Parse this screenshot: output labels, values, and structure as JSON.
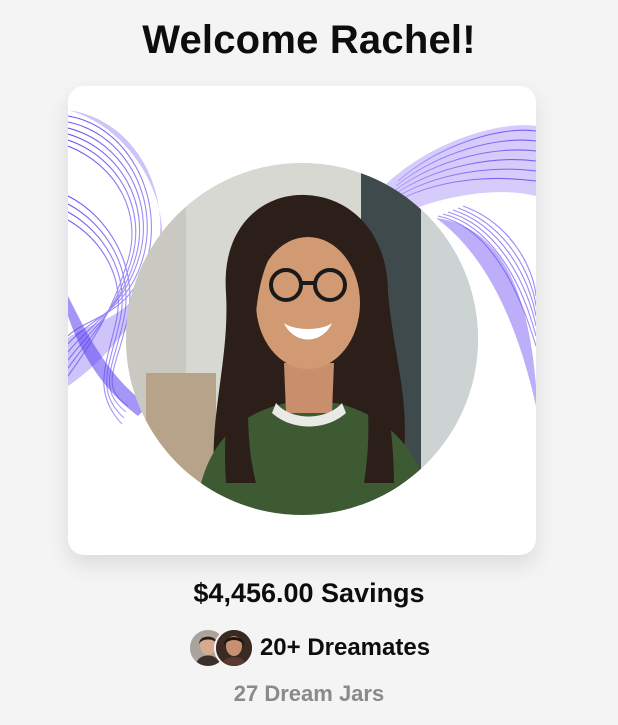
{
  "header": {
    "title": "Welcome Rachel!"
  },
  "profile": {
    "photo_icon": "profile-photo",
    "ribbon_color": "#6a4bf0"
  },
  "stats": {
    "savings": "$4,456.00 Savings",
    "dreamates": "20+ Dreamates",
    "dream_jars": "27 Dream Jars"
  },
  "colors": {
    "background": "#f4f4f5",
    "card": "#ffffff",
    "primary_text": "#0d0d0d",
    "muted_text": "#8a8a8a",
    "accent": "#6a4bf0"
  }
}
